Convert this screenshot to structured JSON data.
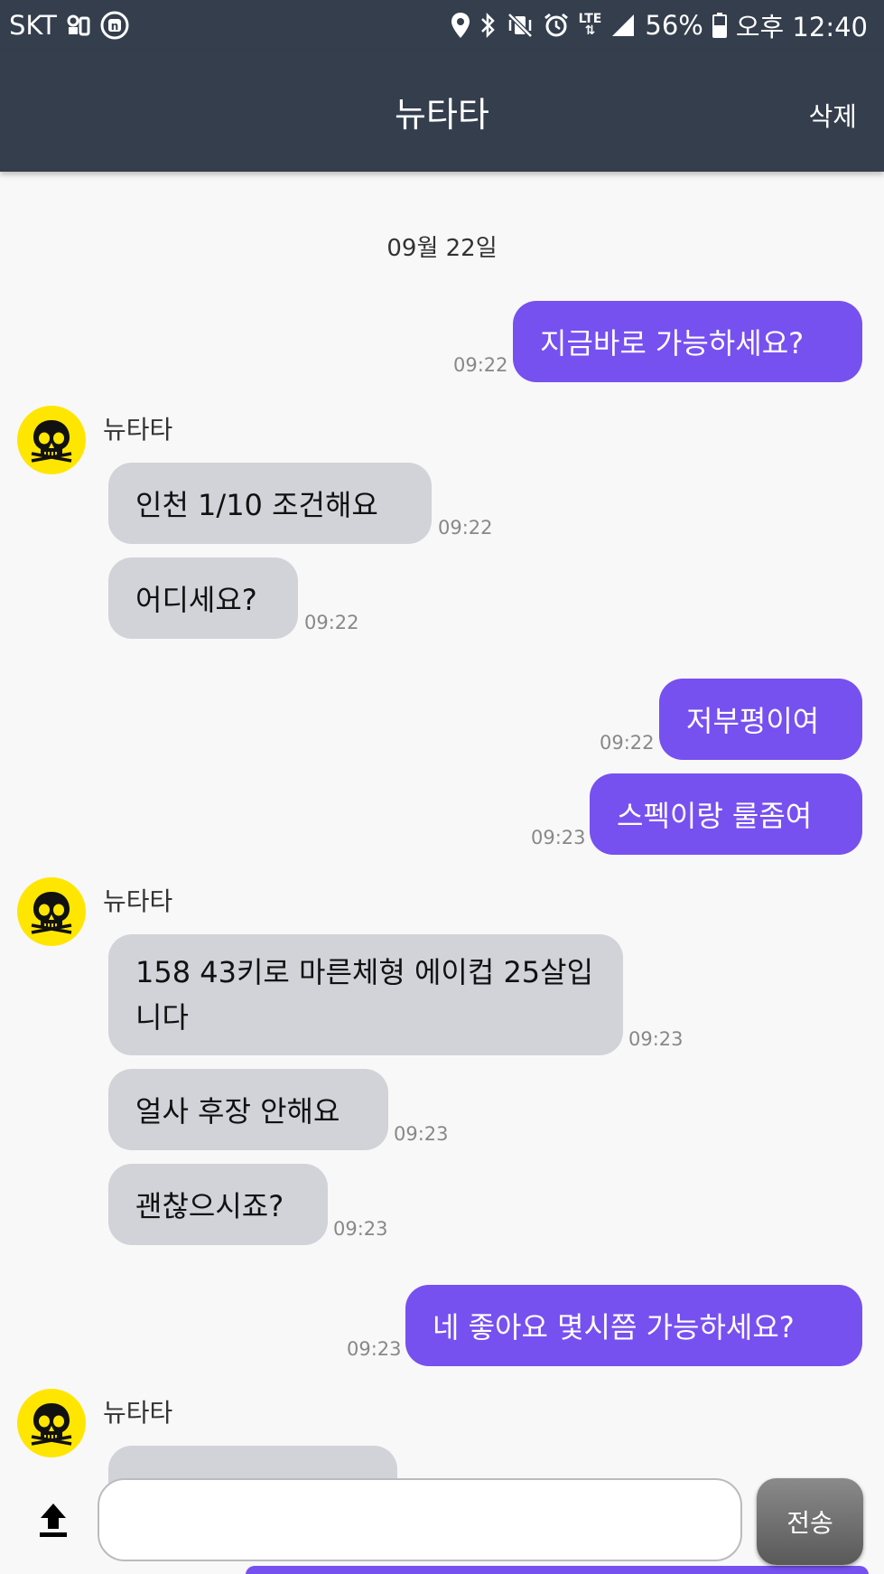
{
  "status_bar": {
    "carrier": "SKT",
    "battery": "56%",
    "time": "오후 12:40",
    "icons": [
      "tv-link-icon",
      "n-badge-icon",
      "location-icon",
      "bluetooth-icon",
      "vibrate-mute-icon",
      "alarm-icon",
      "lte-icon",
      "signal-icon",
      "battery-icon"
    ]
  },
  "header": {
    "title": "뉴타타",
    "delete_label": "삭제"
  },
  "chat": {
    "date_separator": "09월 22일",
    "messages": [
      {
        "dir": "out",
        "text": "지금바로 가능하세요?",
        "time": "09:22"
      },
      {
        "dir": "in",
        "sender": "뉴타타",
        "text": "인천 1/10 조건해요",
        "time": "09:22"
      },
      {
        "dir": "in",
        "text": "어디세요?",
        "time": "09:22"
      },
      {
        "dir": "out",
        "text": "저부평이여",
        "time": "09:22"
      },
      {
        "dir": "out",
        "text": "스펙이랑 룰좀여",
        "time": "09:23"
      },
      {
        "dir": "in",
        "sender": "뉴타타",
        "text": "158 43키로 마른체형 에이컵 25살입니다",
        "time": "09:23"
      },
      {
        "dir": "in",
        "text": "얼사 후장 안해요",
        "time": "09:23"
      },
      {
        "dir": "in",
        "text": "괜찮으시죠?",
        "time": "09:23"
      },
      {
        "dir": "out",
        "text": "네 좋아요 몇시쯤 가능하세요?",
        "time": "09:23"
      },
      {
        "dir": "in",
        "sender": "뉴타타",
        "text": "",
        "time": ""
      }
    ]
  },
  "input_bar": {
    "value": "",
    "placeholder": "",
    "send_label": "전송"
  },
  "colors": {
    "header_bg": "#343e4d",
    "outgoing_bubble": "#7750f0",
    "incoming_bubble": "#d1d3d9",
    "avatar_bg": "#ffe600"
  }
}
